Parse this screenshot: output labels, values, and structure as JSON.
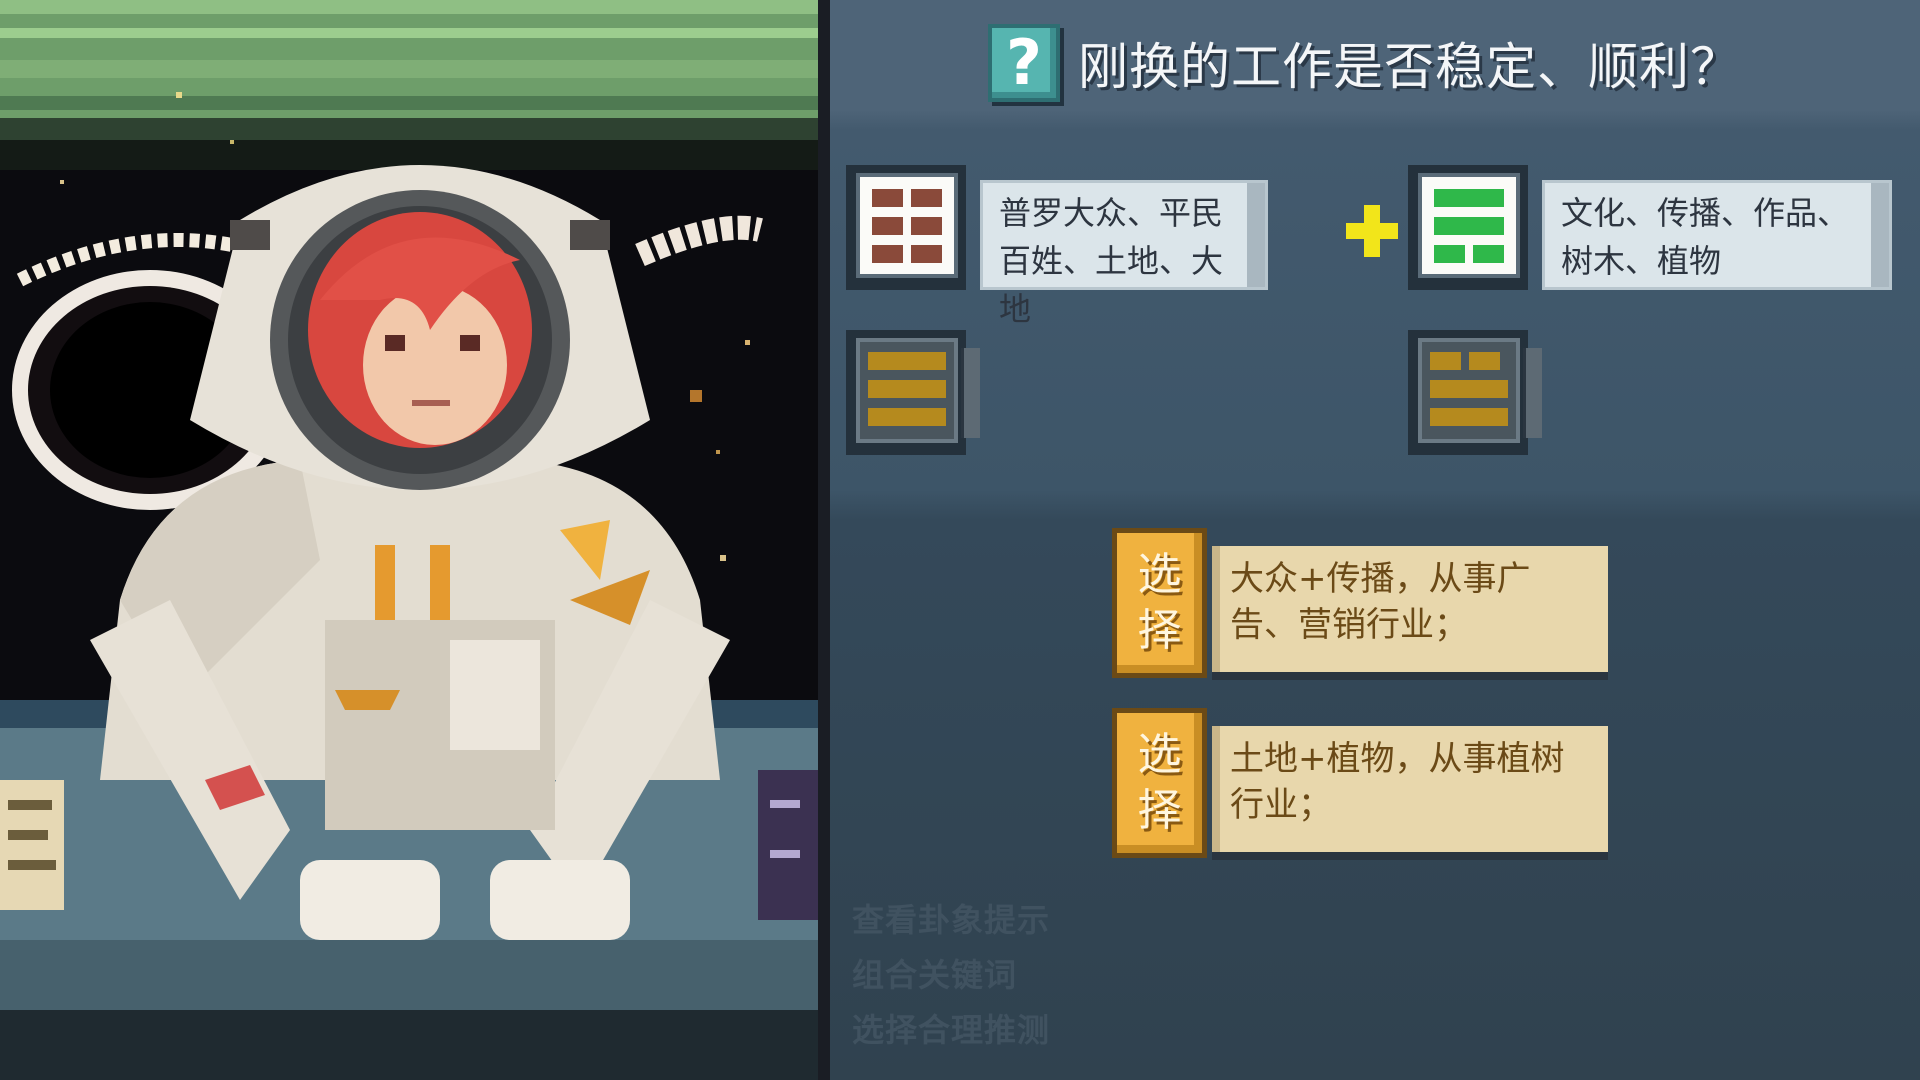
{
  "question": {
    "icon": "question-mark-icon",
    "text": "刚换的工作是否稳定、顺利？"
  },
  "hexagrams": {
    "upper_left": {
      "icon": "kun-trigram-icon",
      "keywords": "普罗大众、平民百姓、土地、大地",
      "color": "#8a4a3a"
    },
    "upper_right": {
      "icon": "xun-trigram-icon",
      "keywords": "文化、传播、作品、树木、植物",
      "color": "#2fb84a"
    },
    "lower_left": {
      "icon": "hidden-trigram-icon",
      "color": "#b58a1e"
    },
    "lower_right": {
      "icon": "hidden-trigram-icon",
      "color": "#b58a1e"
    }
  },
  "plus_icon": "plus-icon",
  "options": [
    {
      "button_top": "选",
      "button_bottom": "择",
      "text": "大众+传播，从事广告、营销行业；"
    },
    {
      "button_top": "选",
      "button_bottom": "择",
      "text": "土地+植物，从事植树行业；"
    }
  ],
  "hints": [
    "查看卦象提示",
    "组合关键词",
    "选择合理推测"
  ],
  "colors": {
    "accent_yellow": "#f2e51a",
    "option_gold": "#f0b23f",
    "question_teal": "#56b5b0"
  }
}
